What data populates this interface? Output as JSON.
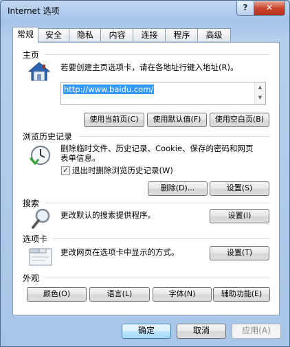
{
  "window": {
    "title": "Internet 选项",
    "help_icon": "?",
    "close_icon": "✕"
  },
  "tabs": [
    {
      "label": "常规",
      "active": true
    },
    {
      "label": "安全"
    },
    {
      "label": "隐私"
    },
    {
      "label": "内容"
    },
    {
      "label": "连接"
    },
    {
      "label": "程序"
    },
    {
      "label": "高级"
    }
  ],
  "homepage": {
    "heading": "主页",
    "description": "若要创建主页选项卡，请在各地址行键入地址(R)。",
    "url": "http://www.baidu.com/",
    "btn_current": "使用当前页(C)",
    "btn_default": "使用默认值(F)",
    "btn_blank": "使用空白页(B)"
  },
  "history": {
    "heading": "浏览历史记录",
    "description": "删除临时文件、历史记录、Cookie、保存的密码和网页表单信息。",
    "checkbox_label": "退出时删除浏览历史记录(W)",
    "checkbox_checked": "✓",
    "btn_delete": "删除(D)...",
    "btn_settings": "设置(S)"
  },
  "search": {
    "heading": "搜索",
    "description": "更改默认的搜索提供程序。",
    "btn_settings": "设置(I)"
  },
  "tabs_section": {
    "heading": "选项卡",
    "description": "更改网页在选项卡中显示的方式。",
    "btn_settings": "设置(T)"
  },
  "appearance": {
    "heading": "外观",
    "btn_colors": "颜色(O)",
    "btn_languages": "语言(L)",
    "btn_fonts": "字体(N)",
    "btn_accessibility": "辅助功能(E)"
  },
  "footer": {
    "btn_ok": "确定",
    "btn_cancel": "取消",
    "btn_apply": "应用(A)"
  }
}
